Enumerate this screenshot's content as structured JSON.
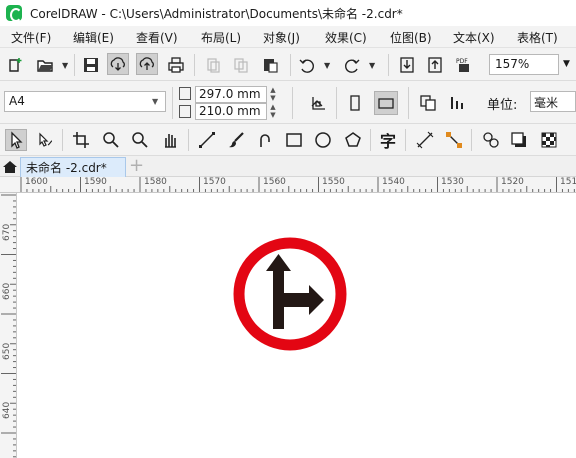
{
  "window": {
    "title": "CorelDRAW - C:\\Users\\Administrator\\Documents\\未命名 -2.cdr*"
  },
  "menu": [
    {
      "label": "文件(F)"
    },
    {
      "label": "编辑(E)"
    },
    {
      "label": "查看(V)"
    },
    {
      "label": "布局(L)"
    },
    {
      "label": "对象(J)"
    },
    {
      "label": "效果(C)"
    },
    {
      "label": "位图(B)"
    },
    {
      "label": "文本(X)"
    },
    {
      "label": "表格(T)"
    }
  ],
  "standard_toolbar": {
    "zoom_level": "157%",
    "publish_pdf_label": "PDF"
  },
  "property_bar": {
    "page_size": "A4",
    "width": "297.0 mm",
    "height": "210.0 mm",
    "units_label": "单位:",
    "units_value": "毫米"
  },
  "toolbox": {
    "text_tool_glyph": "字"
  },
  "tabs": [
    {
      "label": "未命名 -2.cdr*",
      "active": true
    }
  ],
  "new_tab_glyph": "+",
  "ruler": {
    "horizontal": [
      "1600",
      "1590",
      "1580",
      "1570",
      "1560",
      "1550",
      "1540",
      "1530",
      "1520",
      "151"
    ],
    "vertical": [
      "670",
      "660",
      "650",
      "640"
    ]
  },
  "sign": {
    "ring_color": "#e30613",
    "arrow_color": "#231815",
    "depicts": "go-straight-or-turn-right"
  }
}
